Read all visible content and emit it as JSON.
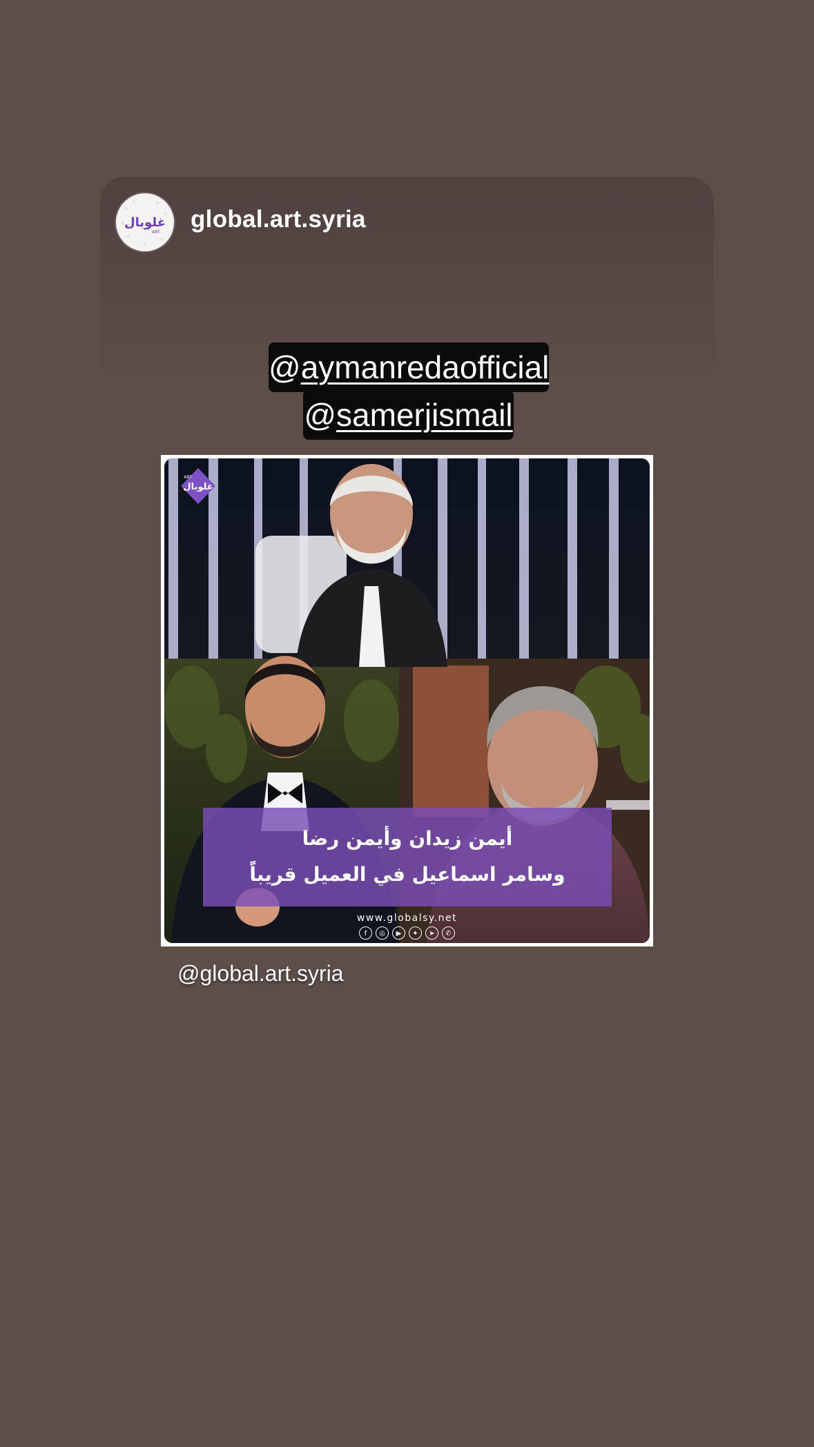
{
  "story": {
    "account": {
      "username": "global.art.syria",
      "avatar_logo_text": "غلوبال",
      "avatar_logo_subtext": "ART"
    },
    "mentions": [
      {
        "prefix": "@",
        "handle": "aymanredaofficial"
      },
      {
        "prefix": "@",
        "handle": "samerjismail"
      }
    ],
    "shared_image": {
      "logo_text": "غلوبال",
      "logo_subtext": "ART",
      "caption_lines": [
        "أيمن زيدان وأيمن رضا",
        "وسامر اسماعيل في العميل قريباً"
      ],
      "site_url": "www.globalsy.net",
      "social_icons": [
        "facebook-icon",
        "instagram-icon",
        "youtube-icon",
        "twitter-icon",
        "telegram-icon",
        "whatsapp-icon"
      ],
      "social_glyphs": [
        "f",
        "◎",
        "▶",
        "✦",
        "➤",
        "✆"
      ]
    },
    "footer_mention": "@global.art.syria"
  },
  "colors": {
    "background": "#5d4e4a",
    "caption_box": "#7a4eb6",
    "mention_bg": "#0b0b0b",
    "logo_purple": "#6b3fb8"
  }
}
